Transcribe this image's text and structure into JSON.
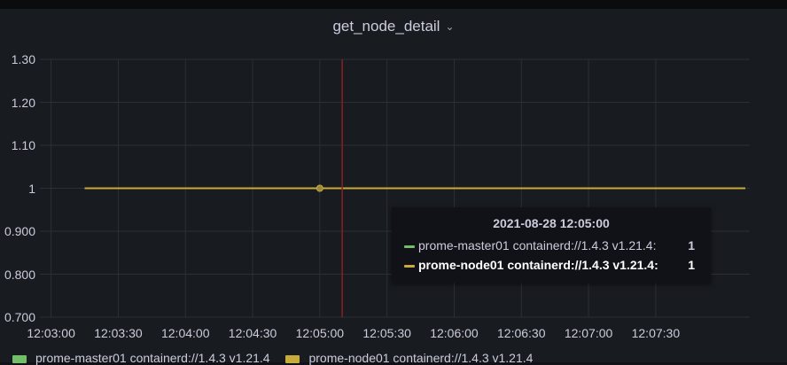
{
  "panel": {
    "title": "get_node_detail",
    "chevron_icon": "chevron-down-icon"
  },
  "colors": {
    "background": "#181b1f",
    "grid": "#2c3036",
    "series_master": "#73bf69",
    "series_node": "#c8ab3a",
    "cursor": "#8b1f20"
  },
  "chart_data": {
    "type": "line",
    "title": "get_node_detail",
    "x_ticks": [
      "12:03:00",
      "12:03:30",
      "12:04:00",
      "12:04:30",
      "12:05:00",
      "12:05:30",
      "12:06:00",
      "12:06:30",
      "12:07:00",
      "12:07:30"
    ],
    "y_ticks": [
      "1.30",
      "1.20",
      "1.10",
      "1",
      "0.900",
      "0.800",
      "0.700"
    ],
    "ylim": [
      0.7,
      1.3
    ],
    "x_range": [
      "12:02:55",
      "12:08:12"
    ],
    "series": [
      {
        "name": "prome-master01 containerd://1.4.3 v1.21.4",
        "color": "#73bf69",
        "x": [
          "12:03:15",
          "12:08:10"
        ],
        "values": [
          1,
          1
        ]
      },
      {
        "name": "prome-node01 containerd://1.4.3 v1.21.4",
        "color": "#c8ab3a",
        "x": [
          "12:03:15",
          "12:08:10"
        ],
        "values": [
          1,
          1
        ]
      }
    ],
    "cursor_time": "12:05:10",
    "hover_point": {
      "x": "12:05:00",
      "y": 1
    },
    "grid": true,
    "legend_position": "bottom"
  },
  "tooltip": {
    "time": "2021-08-28 12:05:00",
    "rows": [
      {
        "label": "prome-master01 containerd://1.4.3 v1.21.4:",
        "value": "1",
        "color": "#73bf69",
        "highlight": false
      },
      {
        "label": "prome-node01 containerd://1.4.3 v1.21.4:",
        "value": "1",
        "color": "#c8ab3a",
        "highlight": true
      }
    ]
  },
  "legend": {
    "items": [
      {
        "label": "prome-master01 containerd://1.4.3 v1.21.4",
        "color": "#73bf69"
      },
      {
        "label": "prome-node01 containerd://1.4.3 v1.21.4",
        "color": "#c8ab3a"
      }
    ]
  }
}
